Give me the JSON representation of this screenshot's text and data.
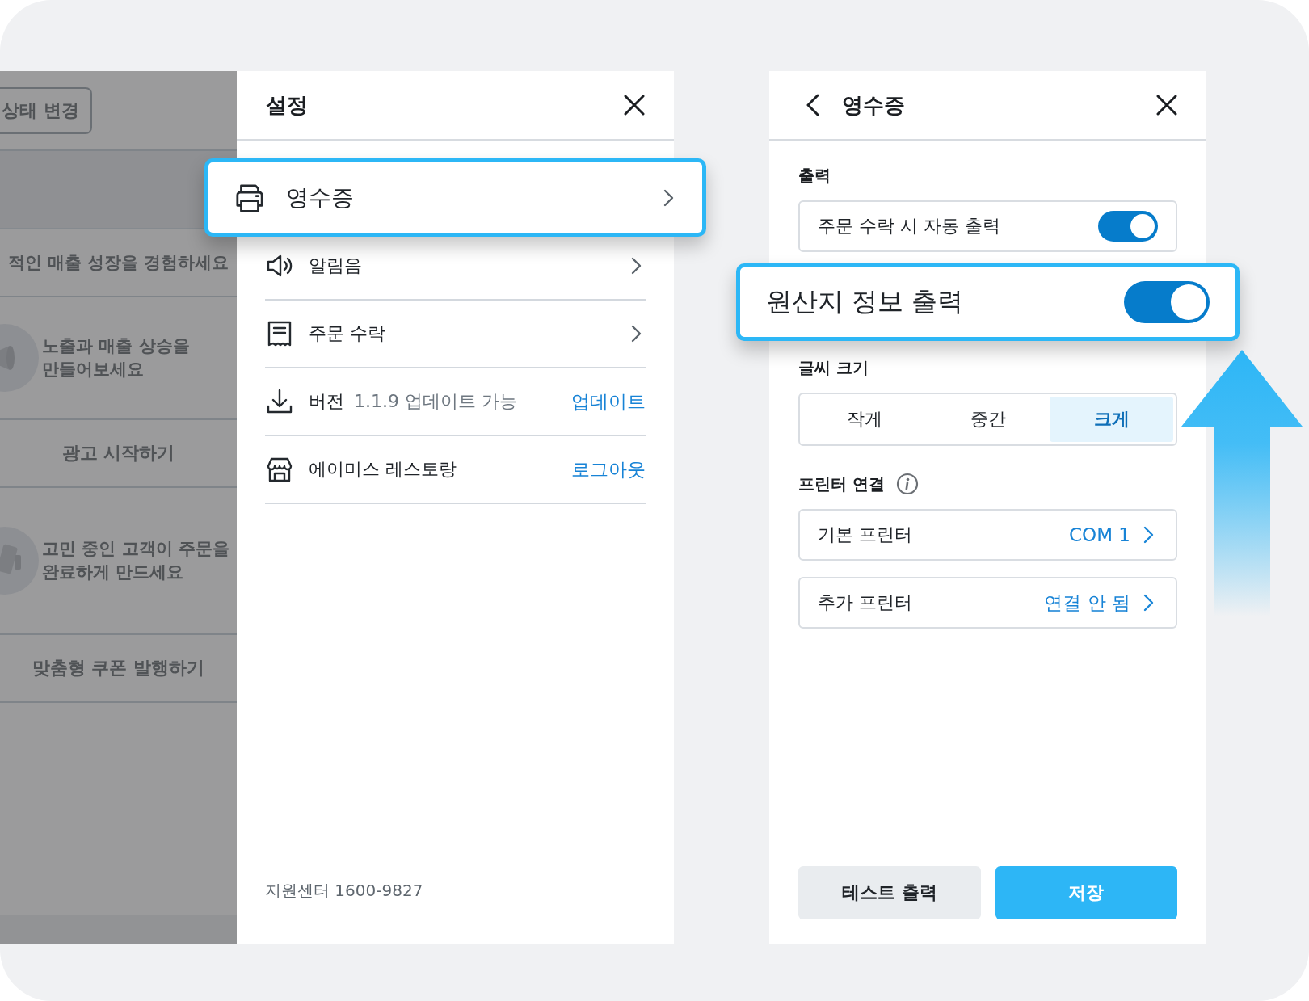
{
  "background_screen": {
    "status_button": "상태 변경",
    "banner": "적인 매출 성장을 경험하세요",
    "promos": [
      {
        "text": "노출과 매출 상승을\n만들어보세요",
        "action": "광고 시작하기"
      },
      {
        "text": "고민 중인 고객이 주문을\n완료하게 만드세요",
        "action": "맞춤형 쿠폰 발행하기"
      }
    ]
  },
  "settings": {
    "title": "설정",
    "items": [
      {
        "kind": "nav",
        "label": "영수증",
        "highlighted": true
      },
      {
        "kind": "nav",
        "label": "알림음",
        "highlighted": false
      },
      {
        "kind": "nav",
        "label": "주문 수락",
        "highlighted": false
      },
      {
        "kind": "action",
        "label": "버전",
        "detail": "1.1.9 업데이트 가능",
        "action": "업데이트",
        "highlighted": false
      },
      {
        "kind": "action",
        "label": "에이미스 레스토랑",
        "action": "로그아웃",
        "highlighted": false
      }
    ],
    "footer": "지원센터 1600-9827"
  },
  "receipt": {
    "title": "영수증",
    "sections": [
      {
        "kind": "toggles",
        "label": "출력",
        "items": [
          {
            "label": "주문 수락 시 자동 출력",
            "on": true,
            "highlighted": false
          },
          {
            "label": "원산지 정보 출력",
            "on": true,
            "highlighted": true
          }
        ]
      },
      {
        "kind": "segmented",
        "label": "글씨 크기",
        "options": [
          {
            "label": "작게",
            "selected": false
          },
          {
            "label": "중간",
            "selected": false
          },
          {
            "label": "크게",
            "selected": true
          }
        ]
      },
      {
        "kind": "links",
        "label": "프린터 연결",
        "info": true,
        "items": [
          {
            "label": "기본 프린터",
            "value": "COM 1"
          },
          {
            "label": "추가 프린터",
            "value": "연결 안 됨"
          }
        ]
      }
    ],
    "buttons": [
      {
        "kind": "secondary",
        "label": "테스트 출력"
      },
      {
        "kind": "primary",
        "label": "저장"
      }
    ]
  }
}
